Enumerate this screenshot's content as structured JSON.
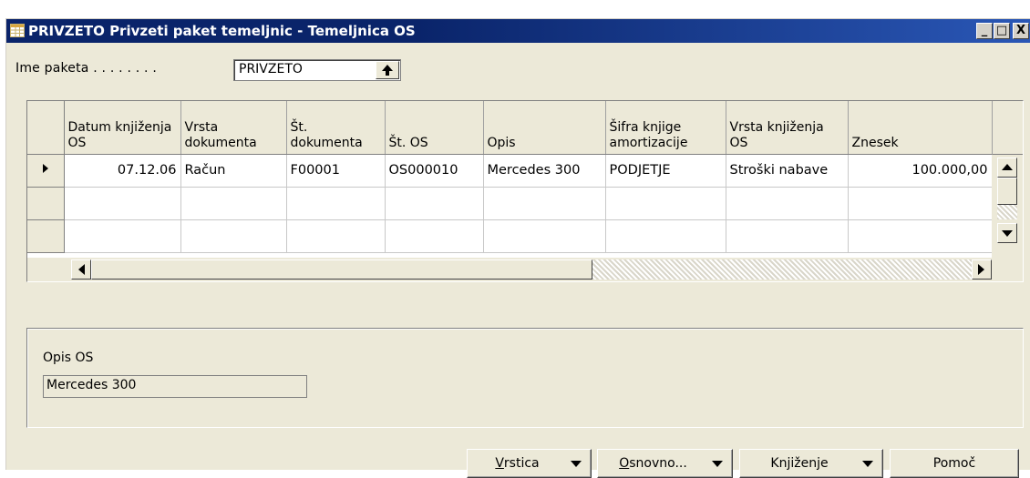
{
  "window": {
    "title": "PRIVZETO Privzeti paket temeljnic - Temeljnica OS",
    "controls": [
      "_",
      "□",
      "X"
    ]
  },
  "batch": {
    "label": "Ime paketa . . . . . . . .",
    "value": "PRIVZETO"
  },
  "grid": {
    "columns": [
      "Datum knjiženja OS",
      "Vrsta dokumenta",
      "Št. dokumenta",
      "Št. OS",
      "Opis",
      "Šifra knjige amortizacije",
      "Vrsta knjiženja OS",
      "Znesek"
    ],
    "rows": [
      [
        "07.12.06",
        "Račun",
        "F00001",
        "OS000010",
        "Mercedes 300",
        "PODJETJE",
        "Stroški nabave",
        "100.000,00"
      ]
    ]
  },
  "info": {
    "label": "Opis OS",
    "value": "Mercedes 300"
  },
  "buttons": {
    "line_rest": "rstica",
    "line_accel": "V",
    "functions_rest": "snovno...",
    "functions_accel": "O",
    "posting": "Knjiženje",
    "help": "Pomoč"
  }
}
